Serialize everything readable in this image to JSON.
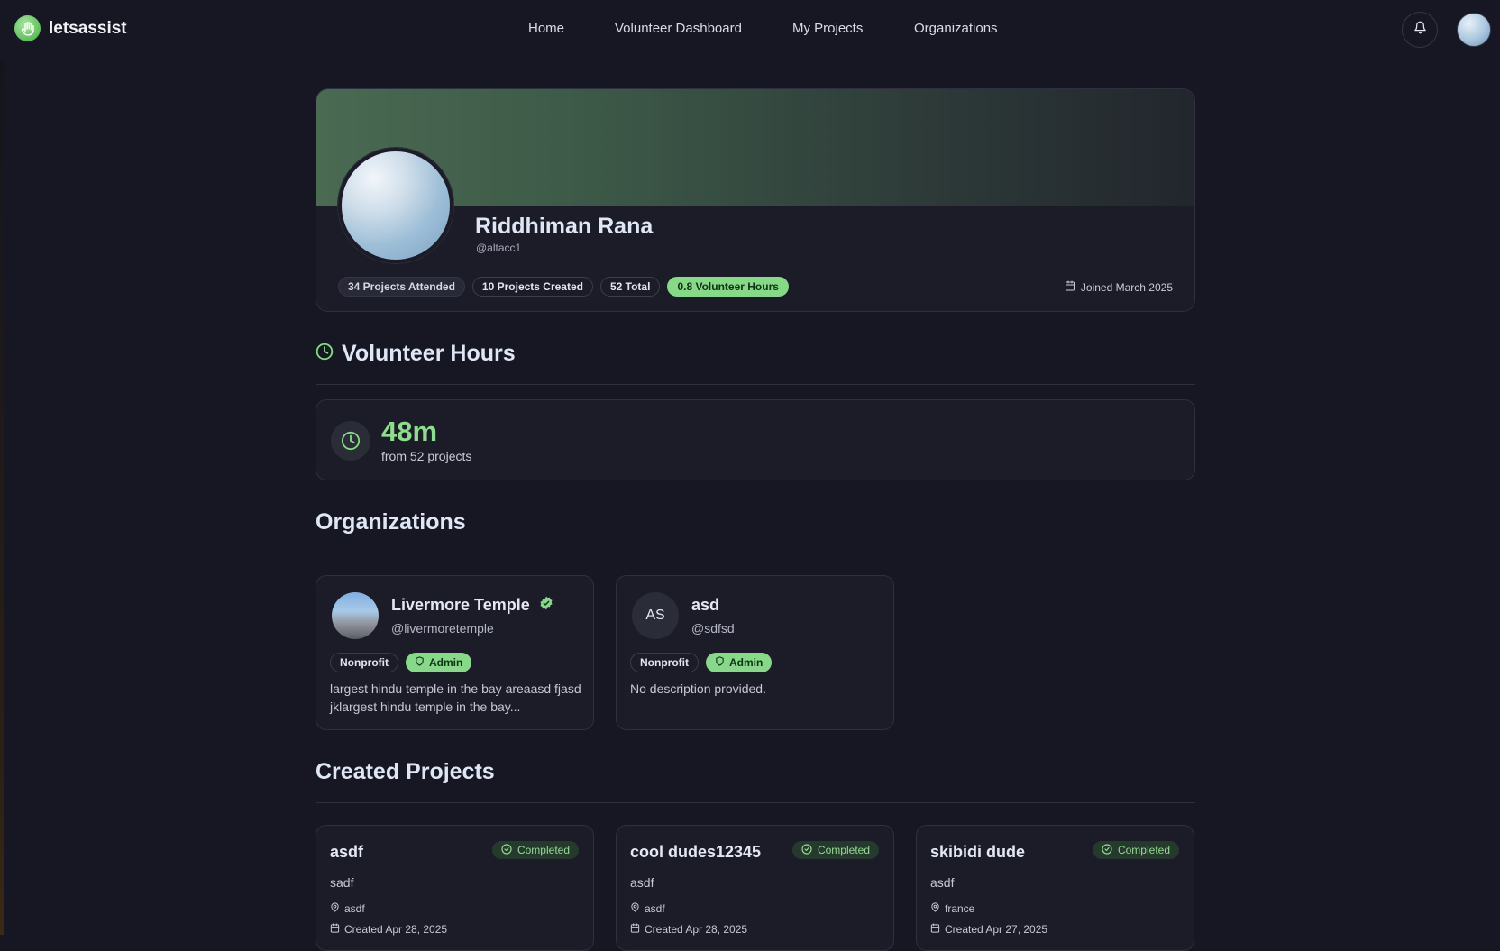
{
  "app": {
    "name": "letsassist"
  },
  "nav": {
    "items": [
      "Home",
      "Volunteer Dashboard",
      "My Projects",
      "Organizations"
    ]
  },
  "profile": {
    "name": "Riddhiman Rana",
    "handle": "@altacc1",
    "badges": [
      "34 Projects Attended",
      "10 Projects Created",
      "52 Total",
      "0.8 Volunteer Hours"
    ],
    "joined": "Joined March 2025"
  },
  "volunteer_hours": {
    "title": "Volunteer Hours",
    "value": "48m",
    "subtitle": "from 52 projects"
  },
  "organizations": {
    "title": "Organizations",
    "items": [
      {
        "name": "Livermore Temple",
        "handle": "@livermoretemple",
        "verified": true,
        "type": "Nonprofit",
        "role": "Admin",
        "description": "largest hindu temple in the bay areaasd fjasd jklargest hindu temple in the bay..."
      },
      {
        "name": "asd",
        "handle": "@sdfsd",
        "initials": "AS",
        "type": "Nonprofit",
        "role": "Admin",
        "description": "No description provided."
      }
    ]
  },
  "created_projects": {
    "title": "Created Projects",
    "items": [
      {
        "title": "asdf",
        "status": "Completed",
        "description": "sadf",
        "location": "asdf",
        "created": "Created Apr 28, 2025"
      },
      {
        "title": "cool dudes12345",
        "status": "Completed",
        "description": "asdf",
        "location": "asdf",
        "created": "Created Apr 28, 2025"
      },
      {
        "title": "skibidi dude",
        "status": "Completed",
        "description": "asdf",
        "location": "france",
        "created": "Created Apr 27, 2025"
      }
    ]
  },
  "colors": {
    "accent_green": "#86d987",
    "background": "#161722",
    "card": "#1b1c28"
  }
}
